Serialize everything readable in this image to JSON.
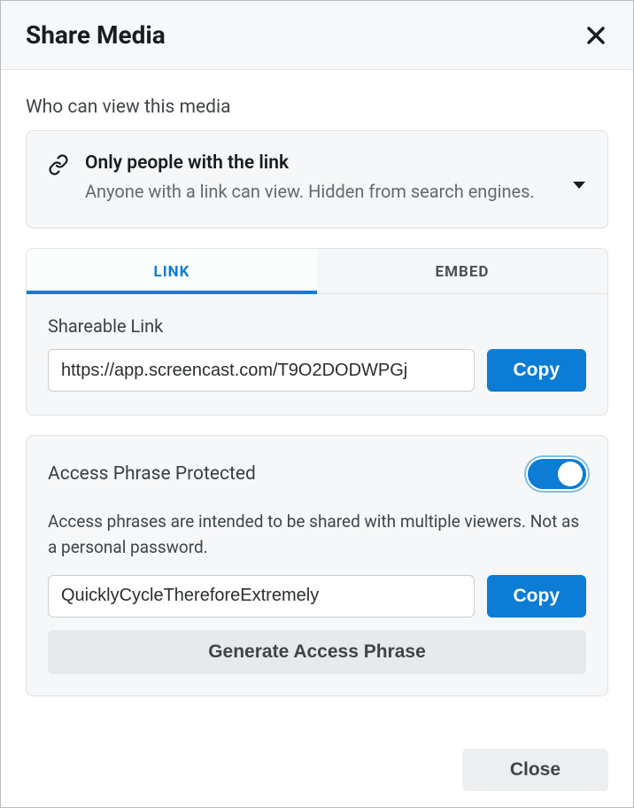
{
  "dialog": {
    "title": "Share Media"
  },
  "visibility": {
    "section_label": "Who can view this media",
    "option_title": "Only people with the link",
    "option_desc": "Anyone with a link can view. Hidden from search engines."
  },
  "tabs": {
    "link": "LINK",
    "embed": "EMBED"
  },
  "link_panel": {
    "label": "Shareable Link",
    "value": "https://app.screencast.com/T9O2DODWPGj",
    "copy": "Copy"
  },
  "phrase": {
    "title": "Access Phrase Protected",
    "desc": "Access phrases are intended to be shared with multiple viewers. Not as a personal password.",
    "value": "QuicklyCycleThereforeExtremely",
    "copy": "Copy",
    "generate": "Generate Access Phrase",
    "enabled": true
  },
  "footer": {
    "close": "Close"
  }
}
